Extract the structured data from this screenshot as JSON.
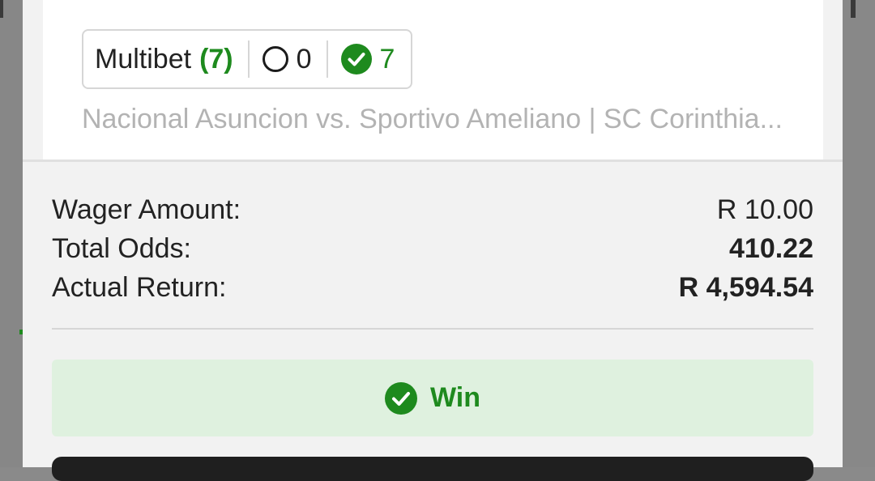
{
  "bet_summary": {
    "type_label": "Multibet",
    "leg_count": "(7)",
    "open_count": "0",
    "won_count": "7",
    "matches": "Nacional Asuncion vs. Sportivo Ameliano | SC Corinthia..."
  },
  "details": {
    "wager_label": "Wager Amount:",
    "wager_value": "R 10.00",
    "odds_label": "Total Odds:",
    "odds_value": "410.22",
    "return_label": "Actual Return:",
    "return_value": "R 4,594.54"
  },
  "result": {
    "label": "Win",
    "icon": "check-circle-icon"
  },
  "colors": {
    "accent_green": "#1e8a1e",
    "result_bg": "#dff1df",
    "muted_text": "#b3b3b3"
  }
}
